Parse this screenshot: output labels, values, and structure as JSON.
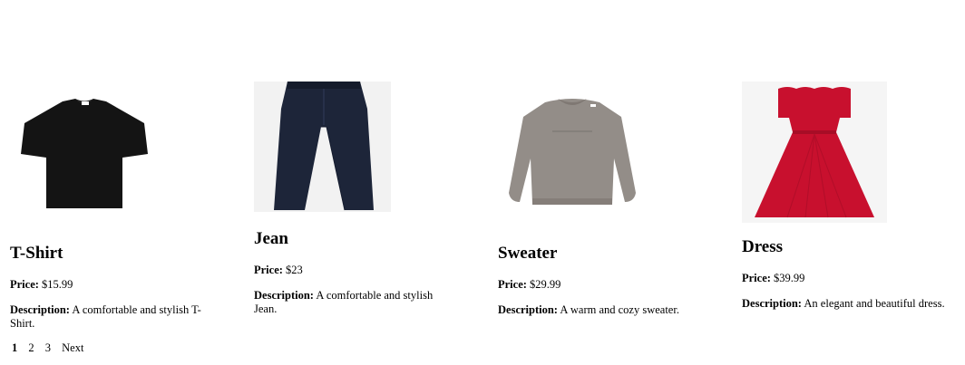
{
  "products": [
    {
      "name": "T-Shirt",
      "price_label": "Price:",
      "price": "$15.99",
      "desc_label": "Description:",
      "description": "A comfortable and stylish T-Shirt.",
      "image": "black-tshirt-image",
      "color": "#111111"
    },
    {
      "name": "Jean",
      "price_label": "Price:",
      "price": "$23",
      "desc_label": "Description:",
      "description": "A comfortable and stylish Jean.",
      "image": "dark-jeans-image",
      "color": "#1c2538"
    },
    {
      "name": "Sweater",
      "price_label": "Price:",
      "price": "$29.99",
      "desc_label": "Description:",
      "description": "A warm and cozy sweater.",
      "image": "gray-sweater-image",
      "color": "#8f8884"
    },
    {
      "name": "Dress",
      "price_label": "Price:",
      "price": "$39.99",
      "desc_label": "Description:",
      "description": "An elegant and beautiful dress.",
      "image": "red-dress-image",
      "color": "#c8102e"
    }
  ],
  "pagination": {
    "current": "1",
    "pages": [
      "2",
      "3"
    ],
    "next_label": "Next"
  }
}
